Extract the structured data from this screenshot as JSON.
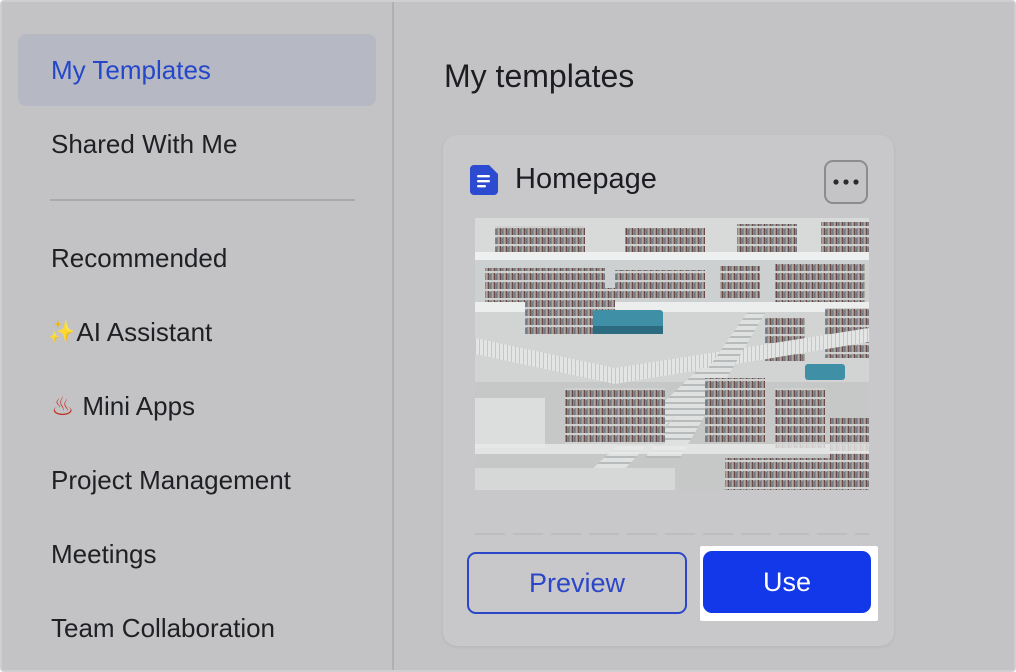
{
  "sidebar": {
    "items": [
      {
        "label": "My Templates",
        "active": true
      },
      {
        "label": "Shared With Me",
        "active": false
      },
      {
        "label": "Recommended",
        "active": false
      },
      {
        "label": "AI Assistant",
        "emoji": "✨",
        "active": false
      },
      {
        "label": "Mini Apps",
        "emoji": "♨",
        "active": false
      },
      {
        "label": "Project Management",
        "active": false
      },
      {
        "label": "Meetings",
        "active": false
      },
      {
        "label": "Team Collaboration",
        "active": false
      }
    ]
  },
  "main": {
    "title": "My templates",
    "card": {
      "title": "Homepage",
      "icon": "document-icon",
      "preview_label": "Preview",
      "use_label": "Use"
    }
  },
  "colors": {
    "accent": "#1238ea",
    "active_text": "#2446c9",
    "active_bg": "#b6b9c4"
  }
}
